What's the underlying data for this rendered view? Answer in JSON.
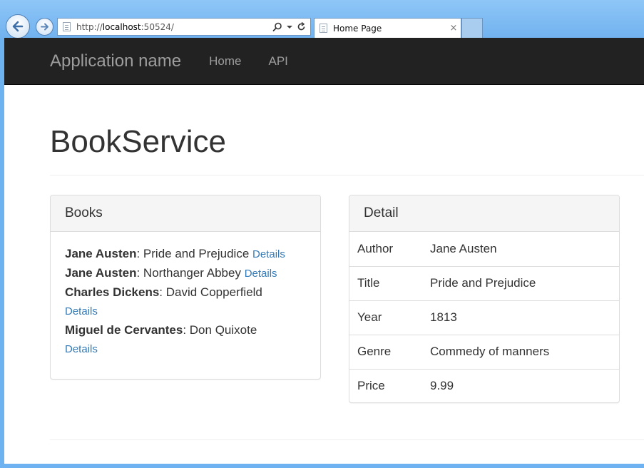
{
  "browser": {
    "address": {
      "scheme": "http://",
      "host": "localhost",
      "port": ":50524/"
    },
    "tab": {
      "title": "Home Page",
      "close": "×"
    }
  },
  "navbar": {
    "brand": "Application name",
    "links": [
      "Home",
      "API"
    ]
  },
  "page": {
    "title": "BookService"
  },
  "books_panel": {
    "heading": "Books",
    "details_label": "Details",
    "items": [
      {
        "author": "Jane Austen",
        "sep": ": ",
        "title": "Pride and Prejudice"
      },
      {
        "author": "Jane Austen",
        "sep": ": ",
        "title": "Northanger Abbey"
      },
      {
        "author": "Charles Dickens",
        "sep": ": ",
        "title": "David Copperfield"
      },
      {
        "author": "Miguel de Cervantes",
        "sep": ": ",
        "title": "Don Quixote"
      }
    ]
  },
  "detail_panel": {
    "heading": "Detail",
    "rows": [
      {
        "label": "Author",
        "value": "Jane Austen"
      },
      {
        "label": "Title",
        "value": "Pride and Prejudice"
      },
      {
        "label": "Year",
        "value": "1813"
      },
      {
        "label": "Genre",
        "value": "Commedy of manners"
      },
      {
        "label": "Price",
        "value": "9.99"
      }
    ]
  },
  "colors": {
    "navbar_bg": "#222222",
    "navbar_text": "#9d9d9d",
    "link": "#337ab7",
    "panel_heading_bg": "#f5f5f5",
    "chrome_blue": "#6fb2f2"
  },
  "icons": {
    "back": "back-arrow-icon",
    "forward": "forward-arrow-icon",
    "search": "search-icon",
    "refresh": "refresh-icon",
    "page": "page-icon"
  }
}
